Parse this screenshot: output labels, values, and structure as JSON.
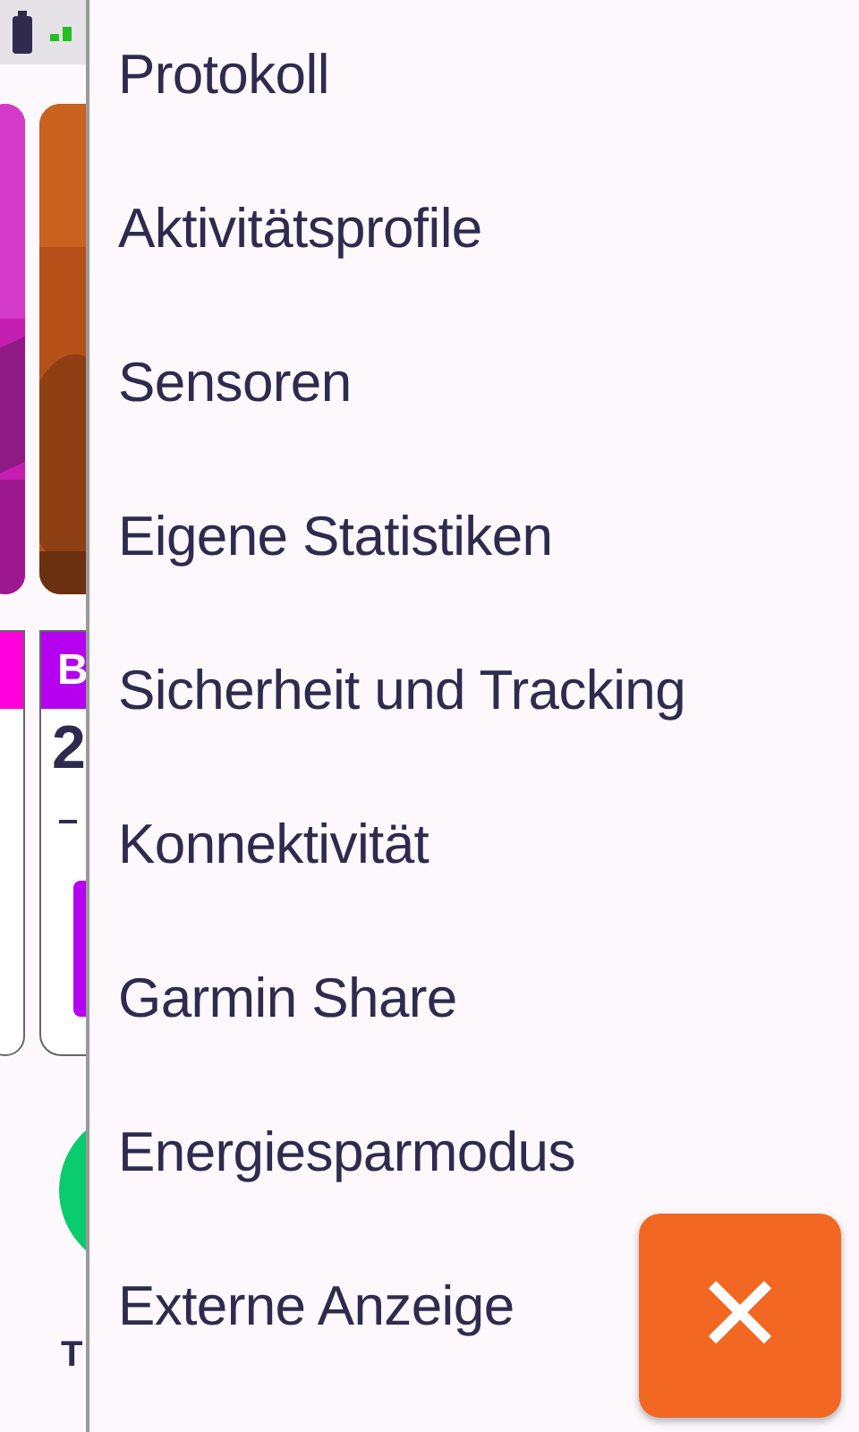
{
  "background": {
    "card_letter": "B",
    "card_value": "2",
    "bottom_label": "T"
  },
  "menu": {
    "items": [
      {
        "label": "Protokoll"
      },
      {
        "label": "Aktivitätsprofile"
      },
      {
        "label": "Sensoren"
      },
      {
        "label": "Eigene Statistiken"
      },
      {
        "label": "Sicherheit und Tracking"
      },
      {
        "label": "Konnektivität"
      },
      {
        "label": "Garmin Share"
      },
      {
        "label": "Energiesparmodus"
      },
      {
        "label": "Externe Anzeige"
      }
    ]
  },
  "close_button": {
    "label": "✕"
  }
}
